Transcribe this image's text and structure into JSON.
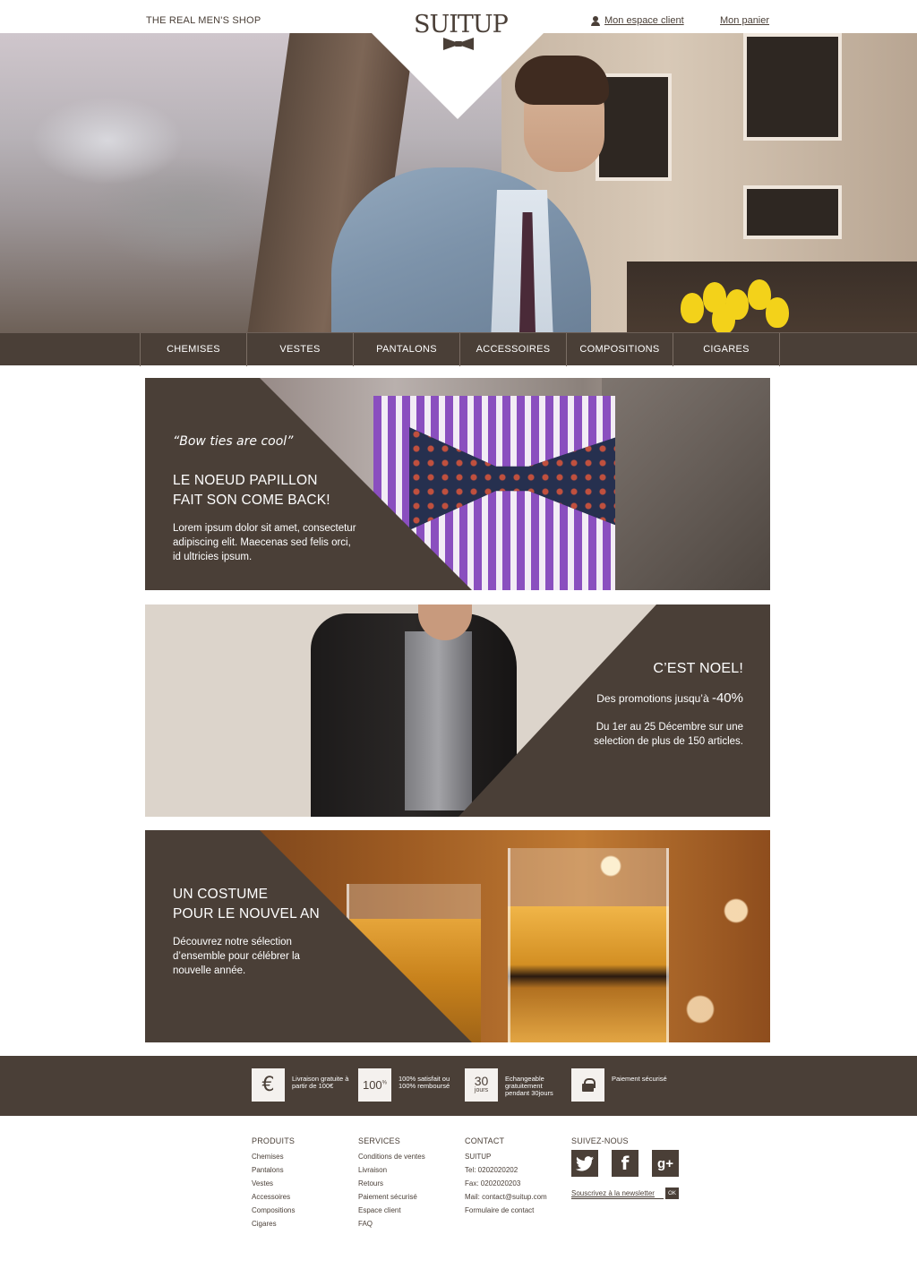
{
  "header": {
    "tagline": "THE REAL MEN'S SHOP",
    "logo_text": "SUITUP",
    "account_link": "Mon espace client",
    "cart_link": "Mon panier"
  },
  "nav": {
    "items": [
      "CHEMISES",
      "VESTES",
      "PANTALONS",
      "ACCESSOIRES",
      "COMPOSITIONS",
      "CIGARES"
    ]
  },
  "banners": {
    "bowtie": {
      "quote": "“Bow ties are cool”",
      "title_line1": "LE NOEUD PAPILLON",
      "title_line2": "FAIT SON COME BACK!",
      "body": "Lorem ipsum dolor sit amet, consectetur adipiscing elit. Maecenas sed felis orci, id ultricies ipsum."
    },
    "noel": {
      "title": "C’EST NOEL!",
      "promo_prefix": "Des promotions jusqu’à ",
      "promo_value": "-40%",
      "body": "Du 1er au 25 Décembre sur une selection de plus de 150 articles."
    },
    "nouvel_an": {
      "title_line1": "UN COSTUME",
      "title_line2": "POUR LE NOUVEL AN",
      "body": "Découvrez notre sélection d’ensemble pour célébrer la nouvelle année."
    }
  },
  "features": [
    {
      "icon": "euro-icon",
      "box_text": "€",
      "text": "Livraison gratuite à partir de 100€"
    },
    {
      "icon": "percent-icon",
      "box_text": "100",
      "box_sup": "%",
      "text": "100% satisfait ou 100% remboursé"
    },
    {
      "icon": "calendar-icon",
      "box_text": "30",
      "box_sub": "jours",
      "text": "Echangeable gratuitement pendant 30jours"
    },
    {
      "icon": "lock-icon",
      "box_text": "",
      "text": "Paiement sécurisé"
    }
  ],
  "footer": {
    "produits": {
      "title": "PRODUITS",
      "items": [
        "Chemises",
        "Pantalons",
        "Vestes",
        "Accessoires",
        "Compositions",
        "Cigares"
      ]
    },
    "services": {
      "title": "SERVICES",
      "items": [
        "Conditions de ventes",
        "Livraison",
        "Retours",
        "Paiement sécurisé",
        "Espace client",
        "FAQ"
      ]
    },
    "contact": {
      "title": "CONTACT",
      "items": [
        "SUITUP",
        "Tel: 0202020202",
        "Fax: 0202020203",
        "Mail: contact@suitup.com",
        "Formulaire de contact"
      ]
    },
    "social": {
      "title": "SUIVEZ-NOUS",
      "twitter": "twitter-icon",
      "facebook": "facebook-icon",
      "googleplus": "google-plus-icon",
      "newsletter_label": "Souscrivez à la newsletter",
      "ok_label": "OK"
    }
  },
  "colors": {
    "brand_brown": "#4a3f37",
    "white": "#ffffff"
  }
}
